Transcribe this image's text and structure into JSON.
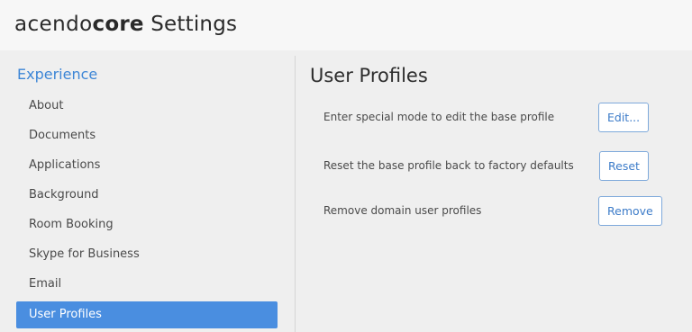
{
  "window": {
    "logo_light": "acendo",
    "logo_bold": "core",
    "title_text": "Settings"
  },
  "sidebar": {
    "heading": "Experience",
    "items": [
      {
        "label": "About",
        "active": false
      },
      {
        "label": "Documents",
        "active": false
      },
      {
        "label": "Applications",
        "active": false
      },
      {
        "label": "Background",
        "active": false
      },
      {
        "label": "Room Booking",
        "active": false
      },
      {
        "label": "Skype for Business",
        "active": false
      },
      {
        "label": "Email",
        "active": false
      },
      {
        "label": "User Profiles",
        "active": true
      }
    ]
  },
  "main": {
    "title": "User Profiles",
    "rows": [
      {
        "description": "Enter special mode to edit the base profile",
        "button": "Edit..."
      },
      {
        "description": "Reset the base profile back to factory defaults",
        "button": "Reset"
      },
      {
        "description": "Remove domain user profiles",
        "button": "Remove"
      }
    ]
  },
  "colors": {
    "accent": "#4a8ee0",
    "heading_blue": "#3d86d6",
    "button_border": "#7ea9db"
  }
}
